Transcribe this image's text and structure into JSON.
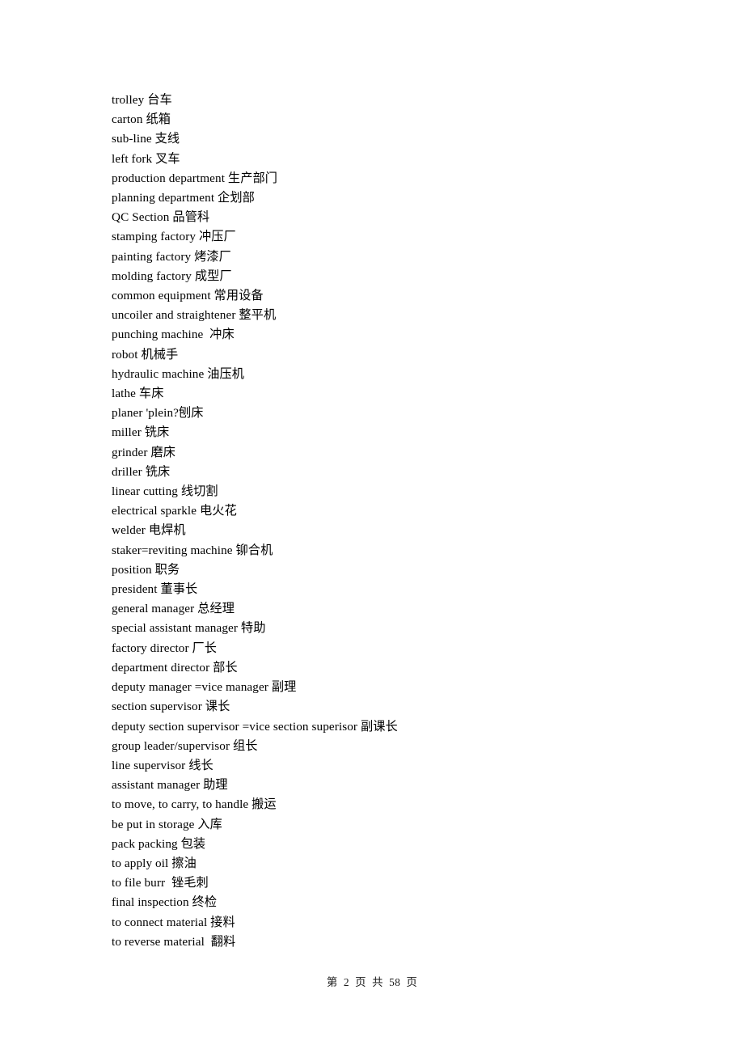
{
  "document": {
    "type": "glossary-page",
    "language_pair": "English-Chinese",
    "background_color": "#ffffff",
    "text_color": "#000000"
  },
  "content": {
    "lines": [
      "trolley 台车",
      "carton 纸箱",
      "sub-line 支线",
      "left fork 叉车",
      "production department 生产部门",
      "planning department 企划部",
      "QC Section 品管科",
      "stamping factory 冲压厂",
      "painting factory 烤漆厂",
      "molding factory 成型厂",
      "common equipment 常用设备",
      "uncoiler and straightener 整平机",
      "punching machine  冲床",
      "robot 机械手",
      "hydraulic machine 油压机",
      "lathe 车床",
      "planer 'plein?刨床",
      "miller 铣床",
      "grinder 磨床",
      "driller 铣床",
      "linear cutting 线切割",
      "electrical sparkle 电火花",
      "welder 电焊机",
      "staker=reviting machine 铆合机",
      "position 职务",
      "president 董事长",
      "general manager 总经理",
      "special assistant manager 特助",
      "factory director 厂长",
      "department director 部长",
      "deputy manager =vice manager 副理",
      "section supervisor 课长",
      "deputy section supervisor =vice section superisor 副课长",
      "group leader/supervisor 组长",
      "line supervisor 线长",
      "assistant manager 助理",
      "to move, to carry, to handle 搬运",
      "be put in storage 入库",
      "pack packing 包装",
      "to apply oil 擦油",
      "to file burr  锉毛刺",
      "final inspection 终检",
      "to connect material 接料",
      "to reverse material  翻料"
    ]
  },
  "footer": {
    "page_label": "第",
    "current_page": "2",
    "of_label": "页  共",
    "total_pages": "58",
    "unit_label": "页",
    "full_text": "第  2  页  共  58  页"
  }
}
